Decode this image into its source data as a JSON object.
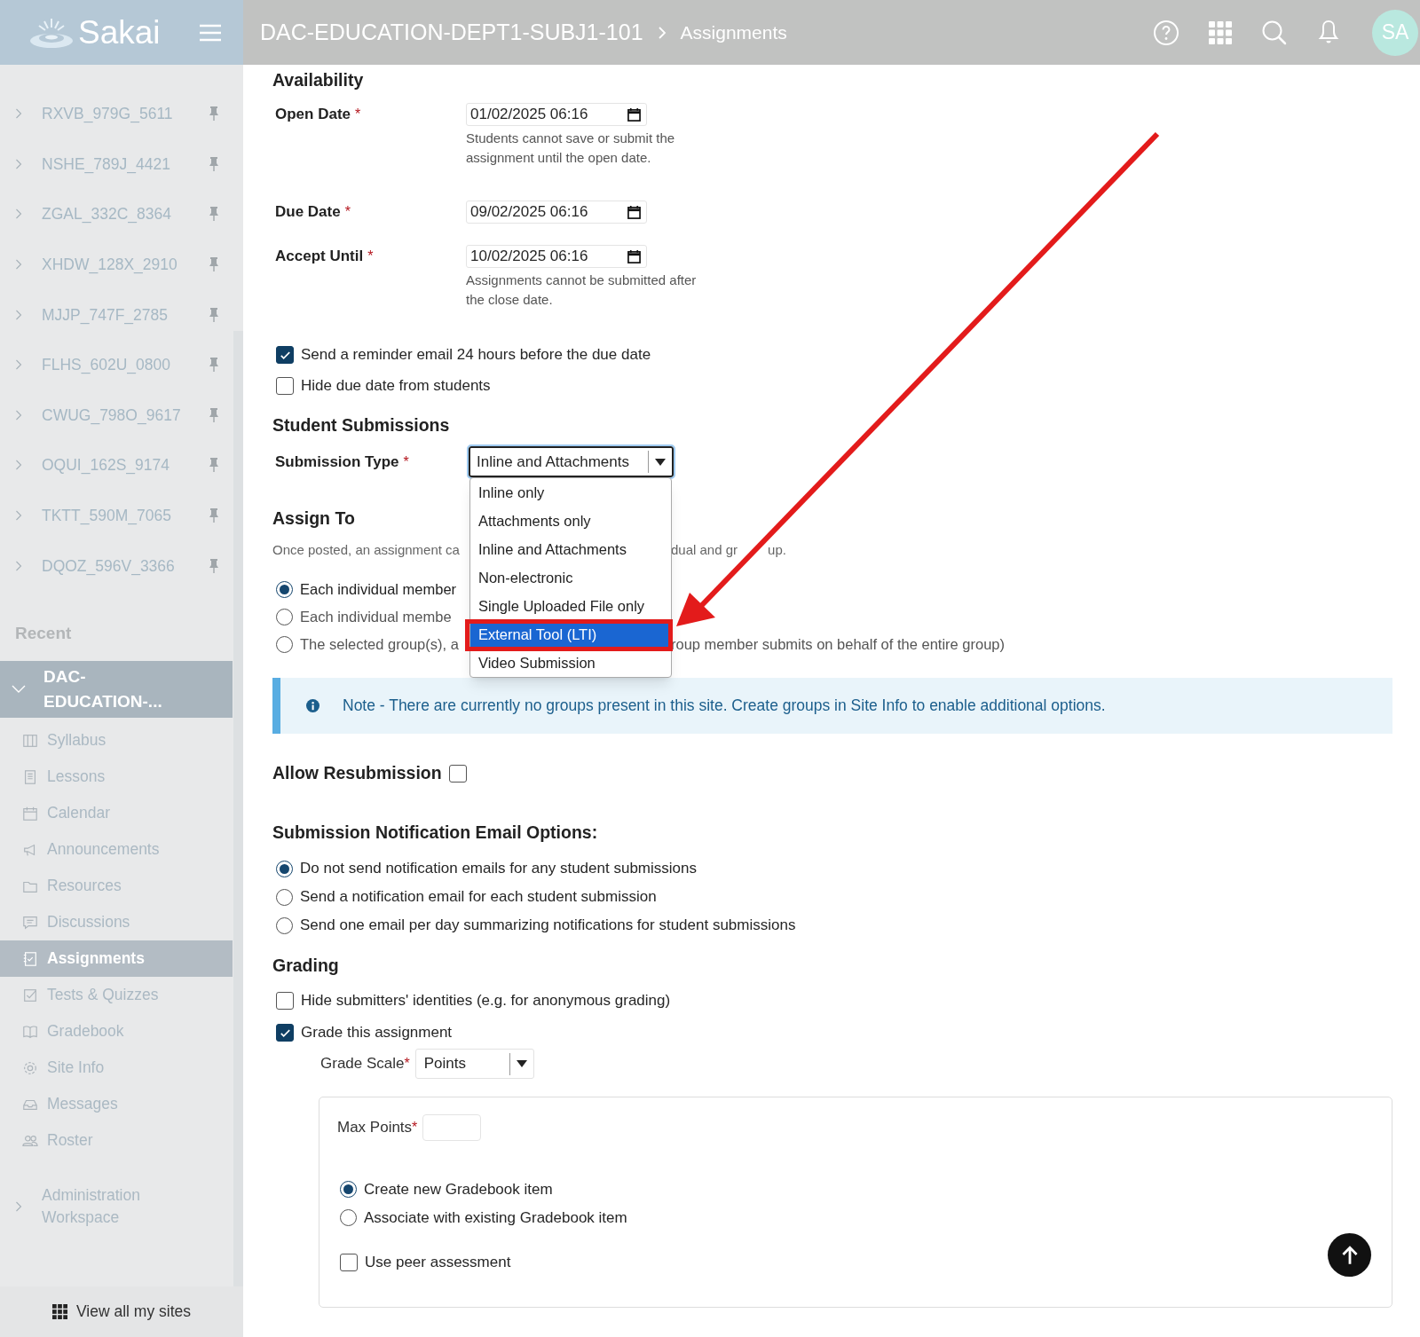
{
  "header": {
    "logo": "Sakai",
    "breadcrumb": [
      {
        "label": "DAC-EDUCATION-DEPT1-SUBJ1-101"
      },
      {
        "label": "Assignments"
      }
    ],
    "avatar": "SA"
  },
  "sidebar": {
    "sites": [
      {
        "label": "RXVB_979G_5611"
      },
      {
        "label": "NSHE_789J_4421"
      },
      {
        "label": "ZGAL_332C_8364"
      },
      {
        "label": "XHDW_128X_2910"
      },
      {
        "label": "MJJP_747F_2785"
      },
      {
        "label": "FLHS_602U_0800"
      },
      {
        "label": "CWUG_798O_9617"
      },
      {
        "label": "OQUI_162S_9174"
      },
      {
        "label": "TKTT_590M_7065"
      },
      {
        "label": "DQOZ_596V_3366"
      }
    ],
    "recent_heading": "Recent",
    "current_site": {
      "label": "DAC-EDUCATION-...",
      "expanded": true,
      "tools": [
        {
          "label": "Syllabus",
          "selected": false
        },
        {
          "label": "Lessons",
          "selected": false
        },
        {
          "label": "Calendar",
          "selected": false
        },
        {
          "label": "Announcements",
          "selected": false
        },
        {
          "label": "Resources",
          "selected": false
        },
        {
          "label": "Discussions",
          "selected": false
        },
        {
          "label": "Assignments",
          "selected": true
        },
        {
          "label": "Tests & Quizzes",
          "selected": false
        },
        {
          "label": "Gradebook",
          "selected": false
        },
        {
          "label": "Site Info",
          "selected": false
        },
        {
          "label": "Messages",
          "selected": false
        },
        {
          "label": "Roster",
          "selected": false
        }
      ]
    },
    "admin": {
      "label": "Administration Workspace"
    },
    "footer": "View all my sites"
  },
  "availability": {
    "heading": "Availability",
    "dates": [
      {
        "label": "Open Date",
        "mark": "*",
        "value": "01/02/2025 06:16",
        "help": "Students cannot save or submit the assignment until the open date."
      },
      {
        "label": "Due Date",
        "mark": "*",
        "value": "09/02/2025 06:16"
      },
      {
        "label": "Accept Until",
        "mark": "*",
        "value": "10/02/2025 06:16",
        "help": "Assignments cannot be submitted after the close date."
      }
    ],
    "options": [
      {
        "label": "Send a reminder email 24 hours before the due date",
        "checked": true
      },
      {
        "label": "Hide due date from students",
        "checked": false
      }
    ]
  },
  "student_submissions": {
    "heading": "Student Submissions",
    "submission_type": {
      "label": "Submission Type",
      "mark": "*",
      "value": "Inline and Attachments",
      "expanded": true,
      "options": [
        {
          "label": "Inline only",
          "highlighted": false
        },
        {
          "label": "Attachments only",
          "highlighted": false
        },
        {
          "label": "Inline and Attachments",
          "highlighted": false
        },
        {
          "label": "Non-electronic",
          "highlighted": false
        },
        {
          "label": "Single Uploaded File only",
          "highlighted": false
        },
        {
          "label": "External Tool (LTI)",
          "highlighted": true
        },
        {
          "label": "Video Submission",
          "highlighted": false
        }
      ]
    }
  },
  "assign_to": {
    "heading": "Assign To",
    "description": "Once posted, an assignment ca",
    "description_after": "dual and gr",
    "description_end": "up.",
    "options": [
      {
        "label": "Each individual member",
        "selected": true
      },
      {
        "label": "Each individual membe",
        "selected": false
      },
      {
        "label": "The selected group(s), a",
        "label_after": "roup member submits on behalf of the entire group)",
        "selected": false
      }
    ],
    "note": "Note - There are currently no groups present in this site. Create groups in Site Info to enable additional options."
  },
  "resubmission": {
    "label": "Allow Resubmission",
    "checked": false
  },
  "notifications": {
    "heading": "Submission Notification Email Options:",
    "options": [
      {
        "label": "Do not send notification emails for any student submissions",
        "selected": true
      },
      {
        "label": "Send a notification email for each student submission",
        "selected": false
      },
      {
        "label": "Send one email per day summarizing notifications for student submissions",
        "selected": false
      }
    ]
  },
  "grading": {
    "heading": "Grading",
    "options": [
      {
        "label": "Hide submitters' identities (e.g. for anonymous grading)",
        "checked": false
      },
      {
        "label": "Grade this assignment",
        "checked": true
      }
    ],
    "grade_scale": {
      "label": "Grade Scale",
      "mark": "*",
      "value": "Points"
    },
    "max_points": {
      "label": "Max Points",
      "mark": "*"
    },
    "gradebook_options": [
      {
        "label": "Create new Gradebook item",
        "selected": true
      },
      {
        "label": "Associate with existing Gradebook item",
        "selected": false
      }
    ],
    "peer_assessment": {
      "label": "Use peer assessment",
      "checked": false
    }
  }
}
